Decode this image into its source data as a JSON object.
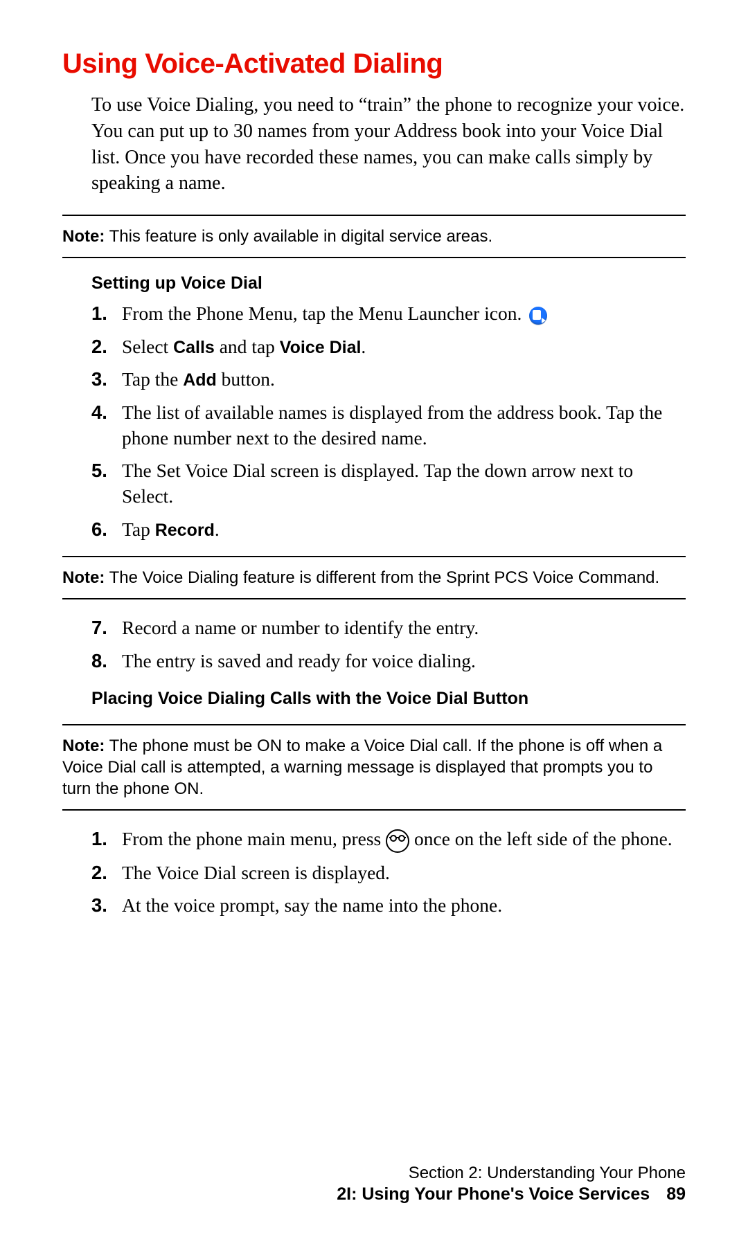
{
  "heading": "Using Voice-Activated Dialing",
  "intro": "To use Voice Dialing, you need to “train” the phone to recognize your voice. You can put up to 30 names from your Address book into your Voice Dial list. Once you have recorded these names, you can make calls simply by speaking a name.",
  "notes": {
    "n1_label": "Note:",
    "n1_text": " This feature is only available in digital service areas.",
    "n2_label": "Note:",
    "n2_text": " The Voice Dialing feature is different from the Sprint PCS Voice Command.",
    "n3_label": "Note:",
    "n3_text": " The phone must be ON to make a Voice Dial call. If the phone is off when a Voice Dial call is attempted, a warning message is displayed that prompts you to turn the phone ON."
  },
  "sub1": "Setting up Voice Dial",
  "stepsA": {
    "n1": "1.",
    "t1a": "From the Phone Menu, tap the Menu Launcher icon. ",
    "n2": "2.",
    "t2a": "Select ",
    "t2b": "Calls",
    "t2c": " and tap ",
    "t2d": "Voice Dial",
    "t2e": ".",
    "n3": "3.",
    "t3a": "Tap the ",
    "t3b": "Add",
    "t3c": " button.",
    "n4": "4.",
    "t4": "The list of available names is displayed from the address book. Tap the phone number next to the desired name.",
    "n5": "5.",
    "t5": "The Set Voice Dial screen is displayed. Tap the down arrow next to Select.",
    "n6": "6.",
    "t6a": "Tap ",
    "t6b": "Record",
    "t6c": "."
  },
  "stepsB": {
    "n7": "7.",
    "t7": "Record a name or number to identify the entry.",
    "n8": "8.",
    "t8": "The entry is saved and ready for voice dialing."
  },
  "sub2": "Placing Voice Dialing Calls with the Voice Dial Button",
  "stepsC": {
    "n1": "1.",
    "t1a": "From the phone main menu, press ",
    "t1b": " once on the left side of the phone.",
    "n2": "2.",
    "t2": "The Voice Dial screen is displayed.",
    "n3": "3.",
    "t3": "At the voice prompt, say the name into the phone."
  },
  "footer": {
    "section": "Section 2: Understanding Your Phone",
    "chapter": "2I: Using Your Phone's Voice Services",
    "page": "89"
  }
}
